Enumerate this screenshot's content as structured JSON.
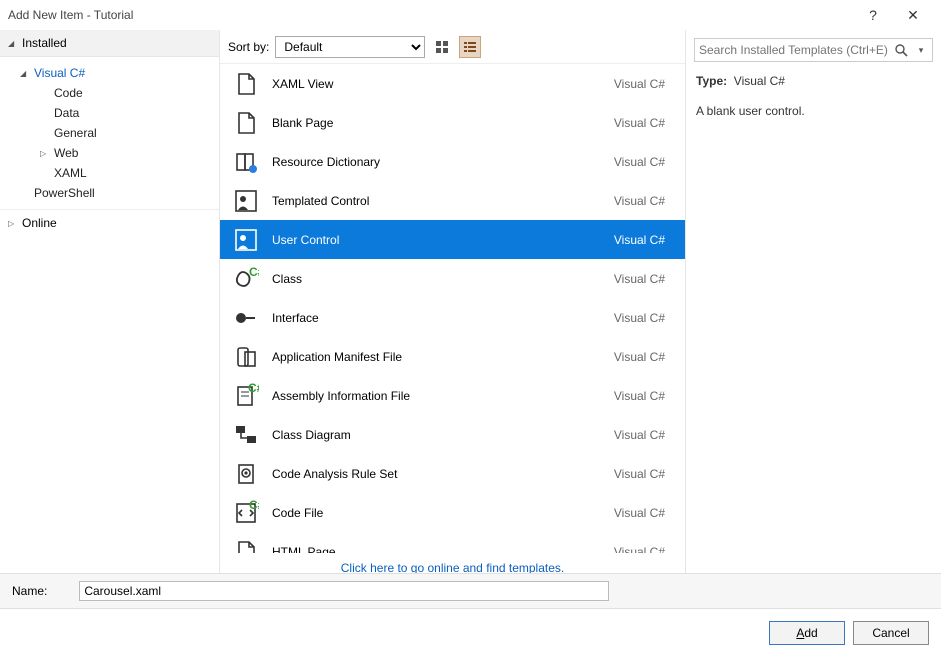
{
  "window": {
    "title": "Add New Item - Tutorial"
  },
  "sidebar": {
    "installed": "Installed",
    "online": "Online",
    "tree": {
      "visualcs": "Visual C#",
      "code": "Code",
      "data": "Data",
      "general": "General",
      "web": "Web",
      "xaml": "XAML",
      "powershell": "PowerShell"
    }
  },
  "sortbar": {
    "label": "Sort by:",
    "value": "Default"
  },
  "templates": [
    {
      "name": "XAML View",
      "lang": "Visual C#",
      "icon": "file-blank"
    },
    {
      "name": "Blank Page",
      "lang": "Visual C#",
      "icon": "file-blank"
    },
    {
      "name": "Resource Dictionary",
      "lang": "Visual C#",
      "icon": "book"
    },
    {
      "name": "Templated Control",
      "lang": "Visual C#",
      "icon": "control-person"
    },
    {
      "name": "User Control",
      "lang": "Visual C#",
      "icon": "control-person",
      "selected": true
    },
    {
      "name": "Class",
      "lang": "Visual C#",
      "icon": "class"
    },
    {
      "name": "Interface",
      "lang": "Visual C#",
      "icon": "interface"
    },
    {
      "name": "Application Manifest File",
      "lang": "Visual C#",
      "icon": "manifest"
    },
    {
      "name": "Assembly Information File",
      "lang": "Visual C#",
      "icon": "assembly"
    },
    {
      "name": "Class Diagram",
      "lang": "Visual C#",
      "icon": "diagram"
    },
    {
      "name": "Code Analysis Rule Set",
      "lang": "Visual C#",
      "icon": "ruleset"
    },
    {
      "name": "Code File",
      "lang": "Visual C#",
      "icon": "codefile"
    },
    {
      "name": "HTML Page",
      "lang": "Visual C#",
      "icon": "file-blank"
    }
  ],
  "online_link": "Click here to go online and find templates.",
  "search": {
    "placeholder": "Search Installed Templates (Ctrl+E)"
  },
  "details": {
    "type_label": "Type:",
    "type_value": "Visual C#",
    "description": "A blank user control."
  },
  "footer": {
    "name_label": "Name:",
    "name_value": "Carousel.xaml"
  },
  "buttons": {
    "add": "Add",
    "cancel": "Cancel"
  }
}
